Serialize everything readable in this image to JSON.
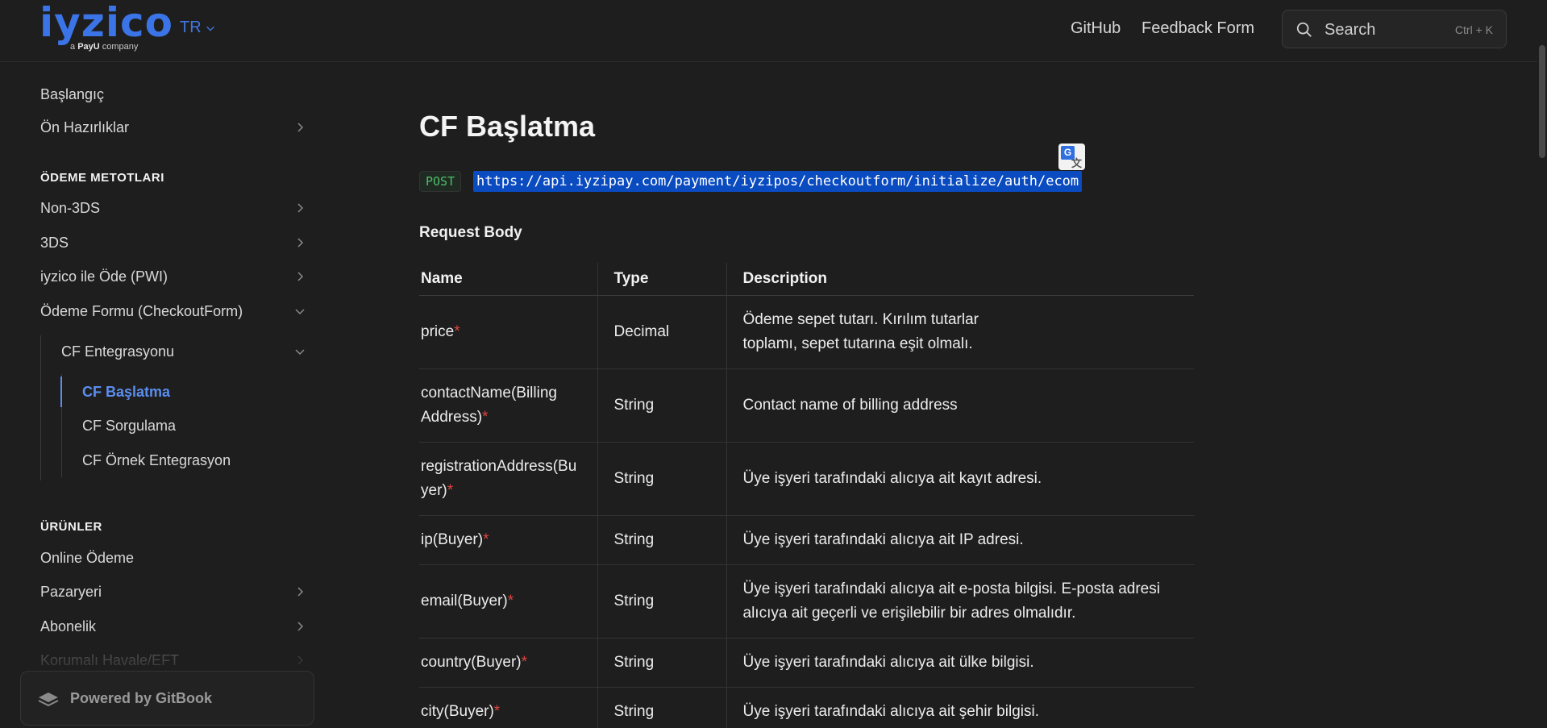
{
  "header": {
    "logo": {
      "word": "iyzico",
      "tagline_prefix": "a",
      "tagline_brand": "PayU",
      "tagline_suffix": "company"
    },
    "lang": "TR",
    "links": [
      "GitHub",
      "Feedback Form"
    ],
    "search": {
      "placeholder": "Search",
      "shortcut": "Ctrl + K"
    }
  },
  "sidebar": {
    "items_top": [
      {
        "label": "Başlangıç",
        "has_chevron": false
      },
      {
        "label": "Ön Hazırlıklar",
        "has_chevron": true
      }
    ],
    "section_payment": "ÖDEME METOTLARI",
    "payment_items": [
      {
        "label": "Non-3DS",
        "chevron": "right"
      },
      {
        "label": "3DS",
        "chevron": "right"
      },
      {
        "label": "iyzico ile Öde (PWI)",
        "chevron": "right"
      },
      {
        "label": "Ödeme Formu (CheckoutForm)",
        "chevron": "down"
      }
    ],
    "sub_group": {
      "label": "CF Entegrasyonu",
      "chevron": "down"
    },
    "sub_items": [
      {
        "label": "CF Başlatma",
        "active": true
      },
      {
        "label": "CF Sorgulama",
        "active": false
      },
      {
        "label": "CF Örnek Entegrasyon",
        "active": false
      }
    ],
    "section_products": "ÜRÜNLER",
    "product_items": [
      {
        "label": "Online Ödeme",
        "chevron": "none"
      },
      {
        "label": "Pazaryeri",
        "chevron": "right"
      },
      {
        "label": "Abonelik",
        "chevron": "right"
      },
      {
        "label": "Korumalı Havale/EFT",
        "chevron": "right"
      }
    ],
    "powered_by": "Powered by GitBook"
  },
  "main": {
    "title": "CF Başlatma",
    "method": "POST",
    "endpoint": "https://api.iyzipay.com/payment/iyzipos/checkoutform/initialize/auth/ecom",
    "request_body_title": "Request Body",
    "table": {
      "headers": [
        "Name",
        "Type",
        "Description"
      ],
      "rows": [
        {
          "name": "price",
          "required": true,
          "type": "Decimal",
          "description": "Ödeme sepet tutarı. Kırılım tutarlar toplamı, sepet tutarına eşit olmalı."
        },
        {
          "name": "contactName(Billing Address)",
          "required": true,
          "type": "String",
          "description": "Contact name of billing address"
        },
        {
          "name": "registrationAddress(Buyer)",
          "required": true,
          "type": "String",
          "description": "Üye işyeri tarafındaki alıcıya ait kayıt adresi."
        },
        {
          "name": "ip(Buyer)",
          "required": true,
          "type": "String",
          "description": "Üye işyeri tarafındaki alıcıya ait IP adresi."
        },
        {
          "name": "email(Buyer)",
          "required": true,
          "type": "String",
          "description": "Üye işyeri tarafındaki alıcıya ait e-posta bilgisi. E-posta adresi alıcıya ait geçerli ve erişilebilir bir adres olmalıdır."
        },
        {
          "name": "country(Buyer)",
          "required": true,
          "type": "String",
          "description": "Üye işyeri tarafındaki alıcıya ait ülke bilgisi."
        },
        {
          "name": "city(Buyer)",
          "required": true,
          "type": "String",
          "description": "Üye işyeri tarafındaki alıcıya ait şehir bilgisi."
        }
      ]
    },
    "required_marker": "*"
  },
  "colors": {
    "accent": "#3b74e6",
    "active": "#5b8ef0",
    "required": "#e0443e",
    "method": "#4fbf6a",
    "selection": "#0a4bc0"
  }
}
